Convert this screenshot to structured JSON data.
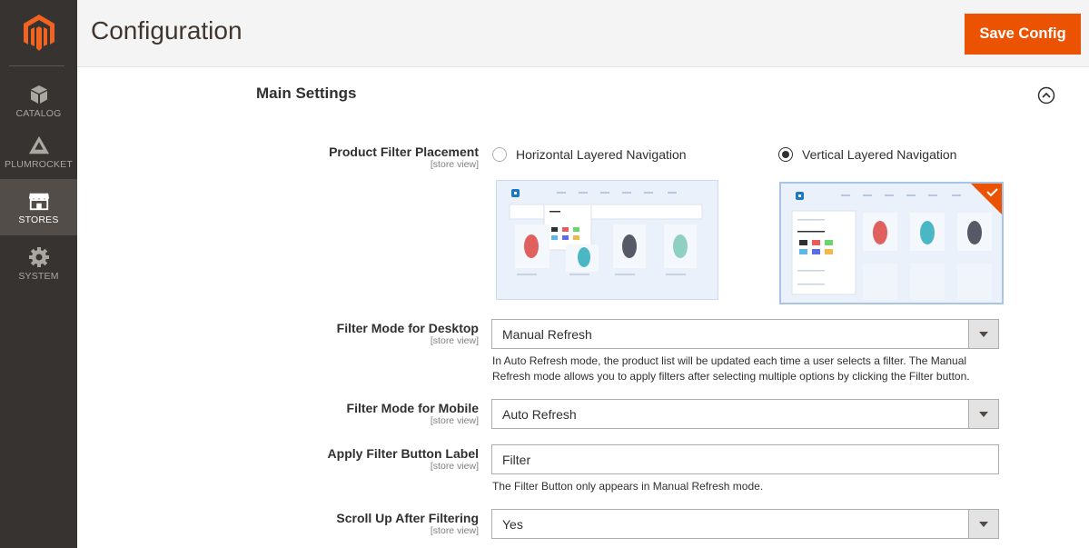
{
  "sidebar": {
    "items": [
      {
        "label": "CATALOG",
        "icon": "cube-icon",
        "active": false
      },
      {
        "label": "PLUMROCKET",
        "icon": "rocket-icon",
        "active": false
      },
      {
        "label": "STORES",
        "icon": "store-icon",
        "active": true
      },
      {
        "label": "SYSTEM",
        "icon": "gear-icon",
        "active": false
      }
    ]
  },
  "header": {
    "title": "Configuration",
    "save_label": "Save Config"
  },
  "section": {
    "title": "Main Settings"
  },
  "fields": {
    "placement": {
      "label": "Product Filter Placement",
      "scope": "[store view]",
      "options": [
        {
          "label": "Horizontal Layered Navigation",
          "checked": false
        },
        {
          "label": "Vertical Layered Navigation",
          "checked": true
        }
      ],
      "preview_brand": "LUMA"
    },
    "desktop_mode": {
      "label": "Filter Mode for Desktop",
      "scope": "[store view]",
      "value": "Manual Refresh",
      "note_line1": "In Auto Refresh mode, the product list will be updated each time a user selects a filter. The Manual",
      "note_line2": "Refresh mode allows you to apply filters after selecting multiple options by clicking the Filter button."
    },
    "mobile_mode": {
      "label": "Filter Mode for Mobile",
      "scope": "[store view]",
      "value": "Auto Refresh"
    },
    "button_label": {
      "label": "Apply Filter Button Label",
      "scope": "[store view]",
      "value": "Filter",
      "note": "The Filter Button only appears in Manual Refresh mode."
    },
    "scroll_up": {
      "label": "Scroll Up After Filtering",
      "scope": "[store view]",
      "value": "Yes"
    }
  },
  "colors": {
    "accent": "#eb5202",
    "sidebar": "#373330",
    "sidebar_active": "#524d49",
    "luma_blue": "#1979c3"
  }
}
